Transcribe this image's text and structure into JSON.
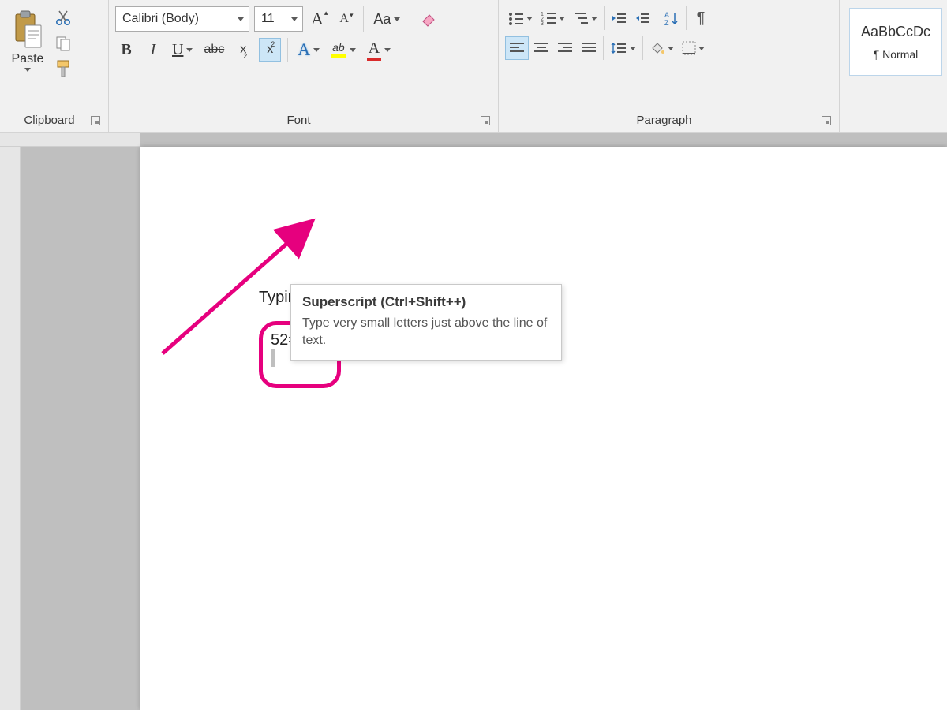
{
  "clipboard": {
    "paste_label": "Paste",
    "group_label": "Clipboard"
  },
  "font": {
    "name": "Calibri (Body)",
    "size": "11",
    "grow_a": "A",
    "shrink_a": "A",
    "case_label": "Aa",
    "bold": "B",
    "italic": "I",
    "underline": "U",
    "strike": "abc",
    "sub_base": "x",
    "sub_small": "2",
    "sup_base": "x",
    "sup_small": "2",
    "text_effect": "A",
    "highlight": "ab",
    "font_color": "A",
    "group_label": "Font"
  },
  "paragraph": {
    "group_label": "Paragraph",
    "pilcrow": "¶"
  },
  "styles": {
    "preview": "AaBbCcDc",
    "name": "¶ Normal"
  },
  "tooltip": {
    "title": "Superscript (Ctrl+Shift++)",
    "body": "Type very small letters just above the line of text."
  },
  "document": {
    "heading": "Typing Exponents",
    "equation": "52=25"
  }
}
